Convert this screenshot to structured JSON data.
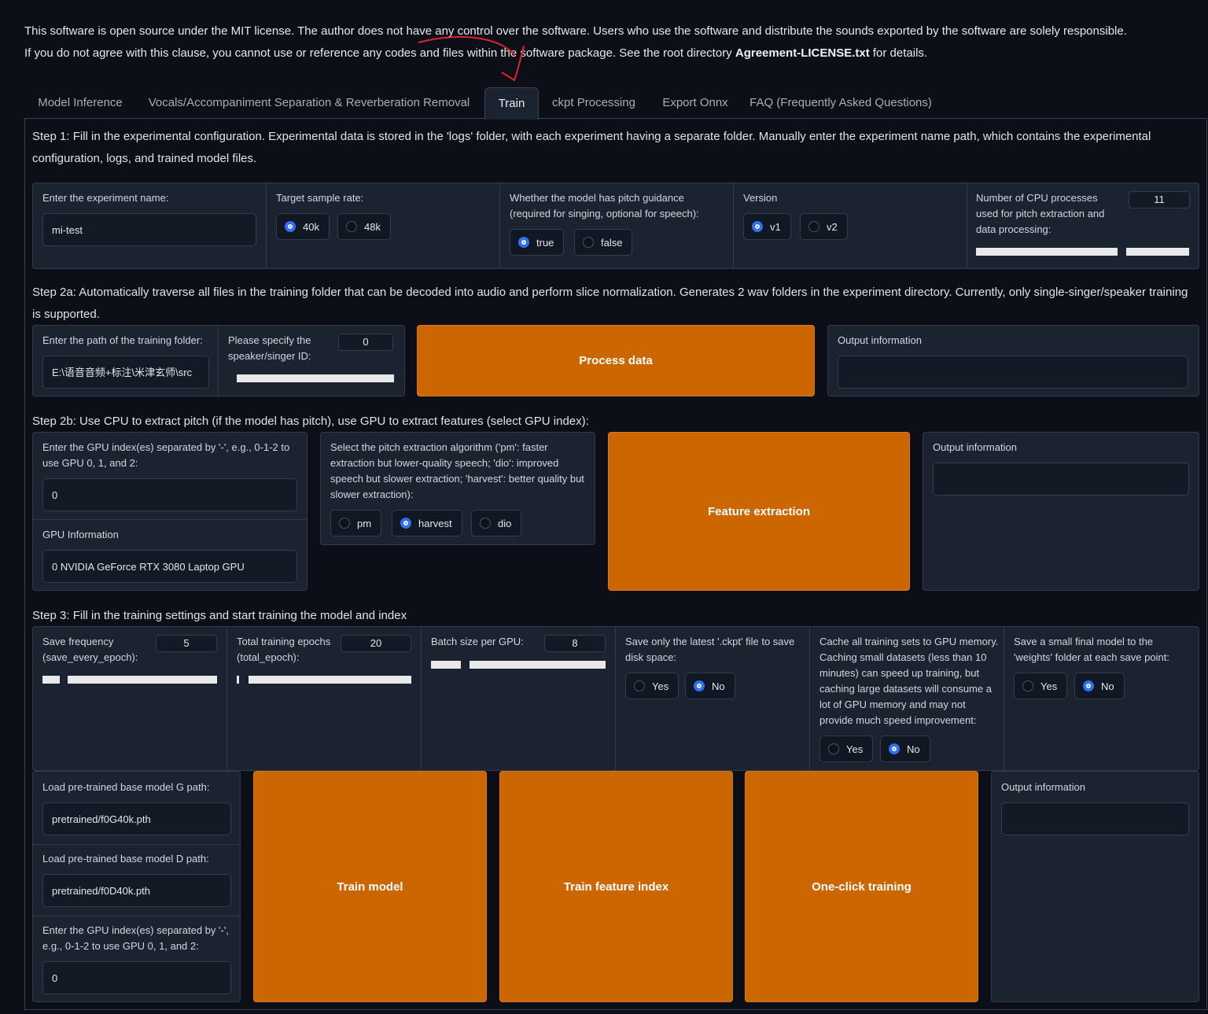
{
  "notice": {
    "line1": "This software is open source under the MIT license. The author does not have any control over the software. Users who use the software and distribute the sounds exported by the software are solely responsible.",
    "line2_pre": "If you do not agree with this clause, you cannot use or reference any codes and files within the software package. See the root directory ",
    "line2_bold": "Agreement-LICENSE.txt",
    "line2_post": " for details."
  },
  "tabs": [
    {
      "label": "Model Inference"
    },
    {
      "label": "Vocals/Accompaniment Separation & Reverberation Removal"
    },
    {
      "label": "Train"
    },
    {
      "label": "ckpt Processing"
    },
    {
      "label": "Export Onnx"
    },
    {
      "label": "FAQ (Frequently Asked Questions)"
    }
  ],
  "step1": {
    "title": "Step 1: Fill in the experimental configuration. Experimental data is stored in the 'logs' folder, with each experiment having a separate folder. Manually enter the experiment name path, which contains the experimental configuration, logs, and trained model files.",
    "exp_name_label": "Enter the experiment name:",
    "exp_name_value": "mi-test",
    "sr_label": "Target sample rate:",
    "sr_options": [
      "40k",
      "48k"
    ],
    "pitch_label": "Whether the model has pitch guidance (required for singing, optional for speech):",
    "pitch_options": [
      "true",
      "false"
    ],
    "version_label": "Version",
    "version_options": [
      "v1",
      "v2"
    ],
    "cpu_label": "Number of CPU processes used for pitch extraction and data processing:",
    "cpu_value": "11",
    "cpu_fraction": 0.69
  },
  "step2a": {
    "title": "Step 2a: Automatically traverse all files in the training folder that can be decoded into audio and perform slice normalization. Generates 2 wav folders in the experiment directory. Currently, only single-singer/speaker training is supported.",
    "folder_label": "Enter the path of the training folder:",
    "folder_value": "E:\\语音音频+标注\\米津玄师\\src",
    "speaker_label": "Please specify the speaker/singer ID:",
    "speaker_value": "0",
    "process_button": "Process data",
    "output_label": "Output information"
  },
  "step2b": {
    "title": "Step 2b: Use CPU to extract pitch (if the model has pitch), use GPU to extract features (select GPU index):",
    "gpu_label": "Enter the GPU index(es) separated by '-', e.g., 0-1-2 to use GPU 0, 1, and 2:",
    "gpu_value": "0",
    "gpu_info_label": "GPU Information",
    "gpu_info_value": "0  NVIDIA GeForce RTX 3080 Laptop GPU",
    "algo_label": "Select the pitch extraction algorithm ('pm': faster extraction but lower-quality speech; 'dio': improved speech but slower extraction; 'harvest': better quality but slower extraction):",
    "algo_options": [
      "pm",
      "harvest",
      "dio"
    ],
    "extract_button": "Feature extraction",
    "output_label": "Output information"
  },
  "step3": {
    "title": "Step 3: Fill in the training settings and start training the model and index",
    "save_freq_label": "Save frequency (save_every_epoch):",
    "save_freq_value": "5",
    "epochs_label": "Total training epochs (total_epoch):",
    "epochs_value": "20",
    "batch_label": "Batch size per GPU:",
    "batch_value": "8",
    "latest_label": "Save only the latest '.ckpt' file to save disk space:",
    "cache_label": "Cache all training sets to GPU memory. Caching small datasets (less than 10 minutes) can speed up training, but caching large datasets will consume a lot of GPU memory and may not provide much speed improvement:",
    "small_label": "Save a small final model to the 'weights' folder at each save point:",
    "yes": "Yes",
    "no": "No",
    "g_label": "Load pre-trained base model G path:",
    "g_value": "pretrained/f0G40k.pth",
    "d_label": "Load pre-trained base model D path:",
    "d_value": "pretrained/f0D40k.pth",
    "gpu_label": "Enter the GPU index(es) separated by '-', e.g., 0-1-2 to use GPU 0, 1, and 2:",
    "gpu_value": "0",
    "train_button": "Train model",
    "index_button": "Train feature index",
    "oneclick_button": "One-click training",
    "output_label": "Output information"
  },
  "colors": {
    "accent": "#cc6600",
    "radio": "#2f6ff2",
    "annotation": "#e0242b"
  }
}
